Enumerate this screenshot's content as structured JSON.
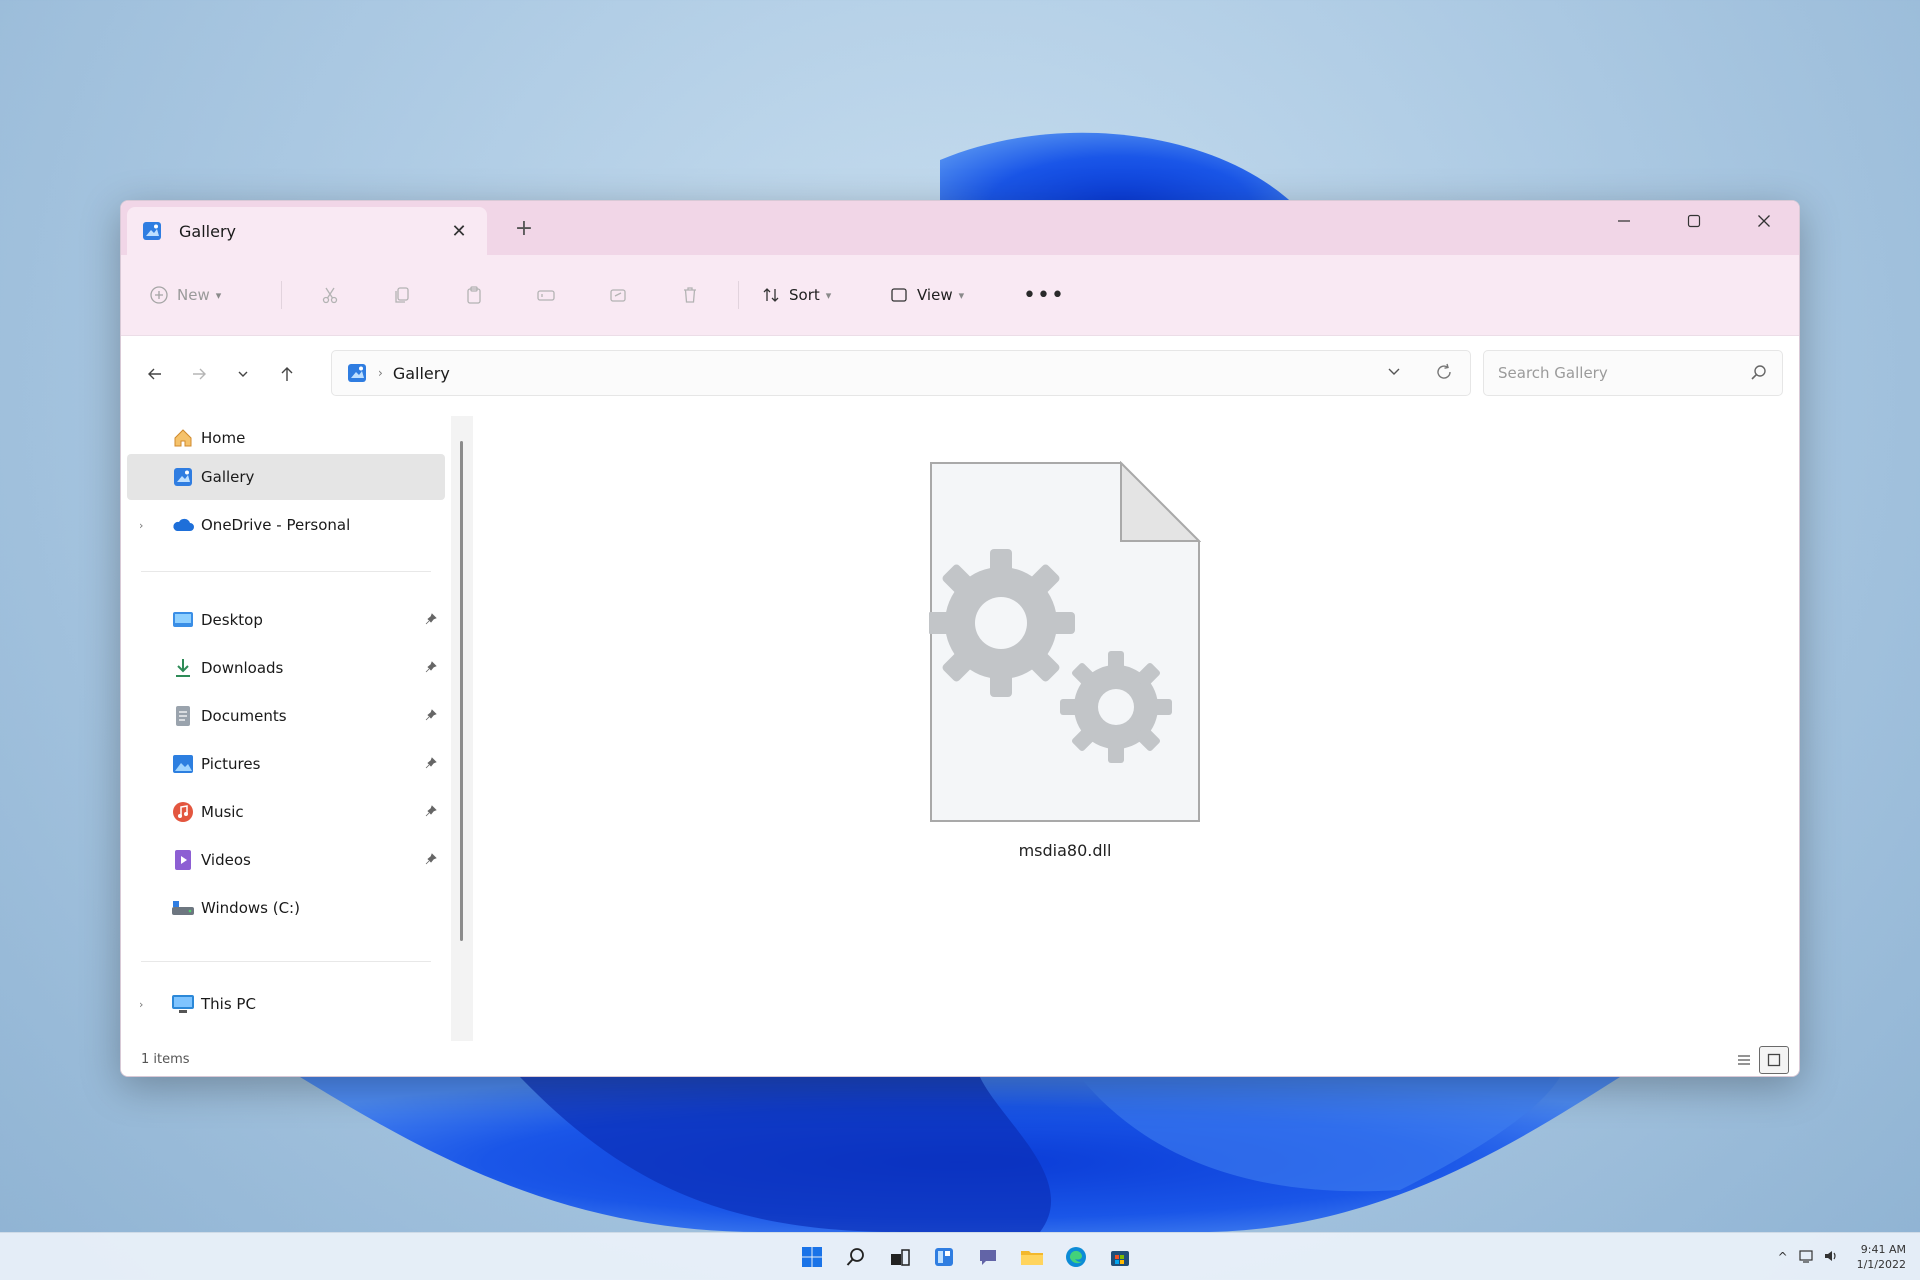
{
  "tab": {
    "title": "Gallery",
    "close_glyph": "✕",
    "new_tab_glyph": "+"
  },
  "window_controls": {
    "minimize": "minimize-icon",
    "maximize": "maximize-icon",
    "close": "close-icon"
  },
  "commandbar": {
    "new_label": "New",
    "disabled_icons": [
      "cut-icon",
      "copy-icon",
      "paste-icon",
      "rename-icon",
      "share-icon",
      "delete-icon"
    ],
    "sort_label": "Sort",
    "view_label": "View",
    "more_glyph": "•••"
  },
  "address": {
    "location_icon": "gallery-icon",
    "separator": "›",
    "crumb": "Gallery",
    "search_placeholder": "Search Gallery"
  },
  "nav": {
    "home": "Home",
    "gallery": "Gallery",
    "onedrive": "OneDrive - Personal",
    "desktop": "Desktop",
    "downloads": "Downloads",
    "documents": "Documents",
    "pictures": "Pictures",
    "music": "Music",
    "videos": "Videos",
    "windows_c": "Windows (C:)",
    "this_pc": "This PC",
    "expander": "›",
    "pin": "📌"
  },
  "content": {
    "file_name": "msdia80.dll",
    "file_icon": "dll-file-icon"
  },
  "status": {
    "item_count": "1 items"
  },
  "taskbar": {
    "icons": [
      "windows-start-icon",
      "search-icon",
      "task-view-icon",
      "widgets-icon",
      "chat-icon",
      "file-explorer-icon",
      "edge-icon",
      "store-icon"
    ],
    "tray_chevron": "^",
    "clock_time": "9:41 AM",
    "clock_date": "1/1/2022"
  },
  "colors": {
    "tab_bar": "#f1d6e7",
    "command_bar": "#f9e9f3",
    "selected": "#e5e5e5",
    "accent": "#1e6fd9"
  }
}
